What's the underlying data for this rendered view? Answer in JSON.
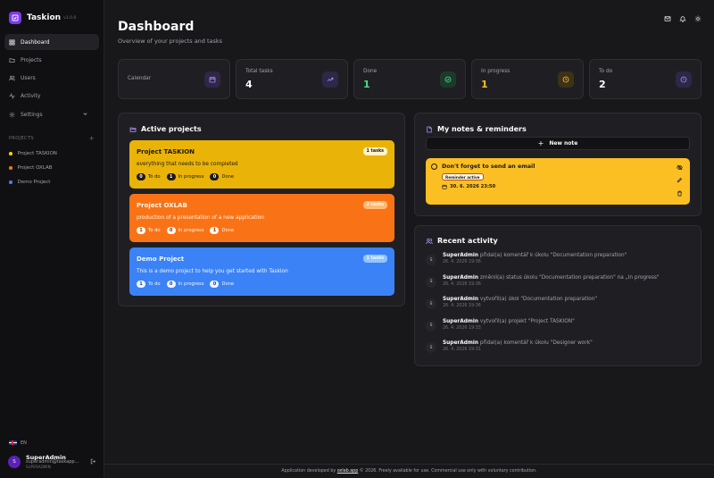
{
  "app": {
    "name": "Taskion",
    "version": "v1.0.0"
  },
  "nav": {
    "dashboard": "Dashboard",
    "projects": "Projects",
    "users": "Users",
    "activity": "Activity",
    "settings": "Settings"
  },
  "sidebar_projects": {
    "heading": "PROJECTS",
    "add_symbol": "+",
    "items": [
      {
        "name": "Project TASKION",
        "color": "#facc15"
      },
      {
        "name": "Project OXLAB",
        "color": "#f97316"
      },
      {
        "name": "Demo Project",
        "color": "#3b82f6"
      }
    ]
  },
  "language": "EN",
  "user": {
    "initial": "S",
    "name": "SuperAdmin",
    "email": "superadmin@taskapp...",
    "role": "SUPERADMIN"
  },
  "header": {
    "title": "Dashboard",
    "subtitle": "Overview of your projects and tasks"
  },
  "stats": [
    {
      "label": "Calendar",
      "value": "",
      "icon": "calendar-icon",
      "color": "#a78bfa",
      "bg": "#2e2748"
    },
    {
      "label": "Total tasks",
      "value": "4",
      "icon": "trend-up-icon",
      "color": "#a78bfa",
      "bg": "#2e2748",
      "value_color": "#fafafa"
    },
    {
      "label": "Done",
      "value": "1",
      "icon": "check-circle-icon",
      "color": "#4ade80",
      "bg": "#1c3a2a",
      "value_color": "#4ade80"
    },
    {
      "label": "In progress",
      "value": "1",
      "icon": "clock-icon",
      "color": "#fbbf24",
      "bg": "#3d3117",
      "value_color": "#fbbf24"
    },
    {
      "label": "To do",
      "value": "2",
      "icon": "alert-circle-icon",
      "color": "#a78bfa",
      "bg": "#2e2748",
      "value_color": "#fafafa"
    }
  ],
  "active_projects": {
    "title": "Active projects",
    "cards": [
      {
        "name": "Project TASKION",
        "desc": "everything that needs to be completed",
        "badge": "1 tasks",
        "todo": "0",
        "inprog": "1",
        "done": "0",
        "bg": "#eab308",
        "fg": "#1c1917",
        "num_bg": "#1c1917",
        "num_fg": "#fafafa",
        "badge_bg": "#fef3c7"
      },
      {
        "name": "Project OXLAB",
        "desc": "production of a presentation of a new application",
        "badge": "2 tasks",
        "todo": "1",
        "inprog": "0",
        "done": "1",
        "bg": "#f97316",
        "fg": "#fff7ed",
        "num_bg": "#fff7ed",
        "num_fg": "#9a3412",
        "badge_bg": "#fdba74"
      },
      {
        "name": "Demo Project",
        "desc": "This is a demo project to help you get started with Taskion",
        "badge": "1 tasks",
        "todo": "1",
        "inprog": "0",
        "done": "0",
        "bg": "#3b82f6",
        "fg": "#eff6ff",
        "num_bg": "#eff6ff",
        "num_fg": "#1e40af",
        "badge_bg": "#93c5fd"
      }
    ],
    "labels": {
      "todo": "To do",
      "inprog": "In progress",
      "done": "Done"
    }
  },
  "notes": {
    "title": "My notes & reminders",
    "new_button": "New note",
    "items": [
      {
        "text": "Don't forget to send an email",
        "reminder": "Reminder active",
        "date": "30. 6. 2026 23:50"
      }
    ]
  },
  "activity": {
    "title": "Recent activity",
    "items": [
      {
        "user": "SuperAdmin",
        "action": "přidal(a) komentář k úkolu \"Documentation preparation\"",
        "time": "26. 4. 2026 19:36"
      },
      {
        "user": "SuperAdmin",
        "action": "změnil(a) status úkolu \"Documentation preparation\" na „In progress\"",
        "time": "26. 4. 2026 19:36"
      },
      {
        "user": "SuperAdmin",
        "action": "vytvořil(a) úkol \"Documentation preparation\"",
        "time": "26. 4. 2026 19:36"
      },
      {
        "user": "SuperAdmin",
        "action": "vytvořil(a) projekt \"Project TASKION\"",
        "time": "26. 4. 2026 19:33"
      },
      {
        "user": "SuperAdmin",
        "action": "přidal(a) komentář k úkolu \"Designer work\"",
        "time": "26. 4. 2026 19:31"
      }
    ]
  },
  "footer": {
    "before": "Application developed by",
    "link": "oxlab.app",
    "after": "© 2026. Freely available for use. Commercial use only with voluntary contribution."
  }
}
